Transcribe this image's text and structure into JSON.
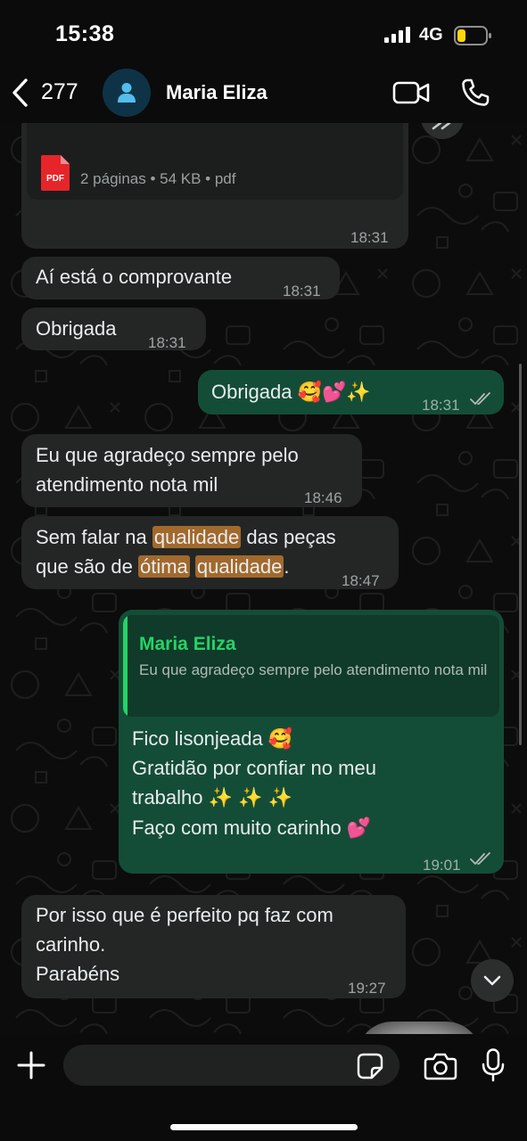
{
  "status_bar": {
    "time": "15:38",
    "network": "4G",
    "battery_color": "#ffd60a"
  },
  "header": {
    "back_count": "277",
    "contact_name": "Maria Eliza"
  },
  "messages": [
    {
      "direction": "in",
      "attachment": {
        "type": "pdf",
        "icon_label": "PDF",
        "meta": "2 páginas • 54 KB • pdf"
      },
      "time": "18:31"
    },
    {
      "direction": "in",
      "text": "Aí está o comprovante",
      "time": "18:31"
    },
    {
      "direction": "in",
      "text": "Obrigada",
      "time": "18:31"
    },
    {
      "direction": "out",
      "text": "Obrigada 🥰💕✨",
      "time": "18:31",
      "status": "read"
    },
    {
      "direction": "in",
      "text_lines": [
        "Eu que agradeço sempre pelo",
        "atendimento nota mil"
      ],
      "time": "18:46"
    },
    {
      "direction": "in",
      "text_segments": [
        "Sem falar na ",
        "qualidade",
        " das peças",
        "que são de ",
        "ótima",
        " ",
        "qualidade",
        "."
      ],
      "highlighted_words": [
        "qualidade",
        "ótima",
        "qualidade"
      ],
      "time": "18:47"
    },
    {
      "direction": "out",
      "quote": {
        "author": "Maria Eliza",
        "text": "Eu que agradeço sempre pelo atendimento nota mil"
      },
      "text_lines": [
        "Fico lisonjeada 🥰",
        "Gratidão por confiar no meu",
        "trabalho ✨ ✨ ✨",
        "Faço com muito carinho 💕"
      ],
      "time": "19:01",
      "status": "read"
    },
    {
      "direction": "in",
      "text_lines": [
        "Por isso que é perfeito pq faz com",
        "carinho.",
        "Parabéns"
      ],
      "time": "19:27"
    }
  ],
  "input": {
    "placeholder": ""
  },
  "icons": [
    "back-icon",
    "avatar-icon",
    "video-call-icon",
    "phone-icon",
    "forward-icon",
    "pdf-icon",
    "double-check-icon",
    "chevron-down-icon",
    "plus-icon",
    "sticker-icon",
    "camera-icon",
    "microphone-icon"
  ],
  "colors": {
    "incoming_bubble": "#232625",
    "outgoing_bubble": "#144d37",
    "accent_green": "#25d366",
    "highlight": "#a2692d",
    "read_ticks": "#b6bab9"
  }
}
